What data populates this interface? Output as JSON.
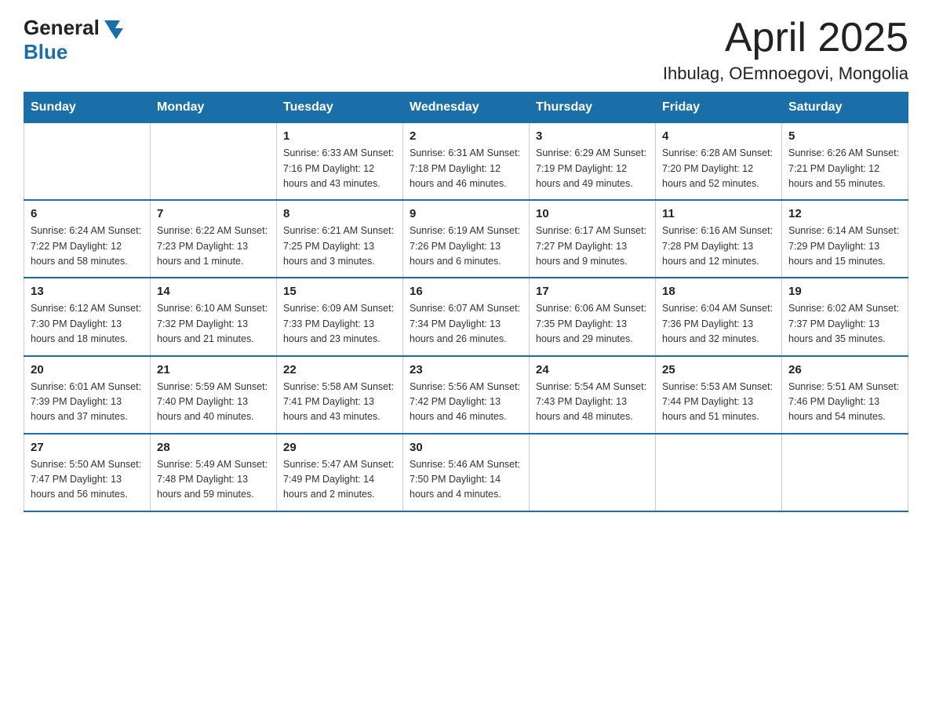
{
  "header": {
    "logo_general": "General",
    "logo_blue": "Blue",
    "title": "April 2025",
    "subtitle": "Ihbulag, OEmnoegovi, Mongolia"
  },
  "days_of_week": [
    "Sunday",
    "Monday",
    "Tuesday",
    "Wednesday",
    "Thursday",
    "Friday",
    "Saturday"
  ],
  "weeks": [
    {
      "days": [
        {
          "number": "",
          "detail": ""
        },
        {
          "number": "",
          "detail": ""
        },
        {
          "number": "1",
          "detail": "Sunrise: 6:33 AM\nSunset: 7:16 PM\nDaylight: 12 hours\nand 43 minutes."
        },
        {
          "number": "2",
          "detail": "Sunrise: 6:31 AM\nSunset: 7:18 PM\nDaylight: 12 hours\nand 46 minutes."
        },
        {
          "number": "3",
          "detail": "Sunrise: 6:29 AM\nSunset: 7:19 PM\nDaylight: 12 hours\nand 49 minutes."
        },
        {
          "number": "4",
          "detail": "Sunrise: 6:28 AM\nSunset: 7:20 PM\nDaylight: 12 hours\nand 52 minutes."
        },
        {
          "number": "5",
          "detail": "Sunrise: 6:26 AM\nSunset: 7:21 PM\nDaylight: 12 hours\nand 55 minutes."
        }
      ]
    },
    {
      "days": [
        {
          "number": "6",
          "detail": "Sunrise: 6:24 AM\nSunset: 7:22 PM\nDaylight: 12 hours\nand 58 minutes."
        },
        {
          "number": "7",
          "detail": "Sunrise: 6:22 AM\nSunset: 7:23 PM\nDaylight: 13 hours\nand 1 minute."
        },
        {
          "number": "8",
          "detail": "Sunrise: 6:21 AM\nSunset: 7:25 PM\nDaylight: 13 hours\nand 3 minutes."
        },
        {
          "number": "9",
          "detail": "Sunrise: 6:19 AM\nSunset: 7:26 PM\nDaylight: 13 hours\nand 6 minutes."
        },
        {
          "number": "10",
          "detail": "Sunrise: 6:17 AM\nSunset: 7:27 PM\nDaylight: 13 hours\nand 9 minutes."
        },
        {
          "number": "11",
          "detail": "Sunrise: 6:16 AM\nSunset: 7:28 PM\nDaylight: 13 hours\nand 12 minutes."
        },
        {
          "number": "12",
          "detail": "Sunrise: 6:14 AM\nSunset: 7:29 PM\nDaylight: 13 hours\nand 15 minutes."
        }
      ]
    },
    {
      "days": [
        {
          "number": "13",
          "detail": "Sunrise: 6:12 AM\nSunset: 7:30 PM\nDaylight: 13 hours\nand 18 minutes."
        },
        {
          "number": "14",
          "detail": "Sunrise: 6:10 AM\nSunset: 7:32 PM\nDaylight: 13 hours\nand 21 minutes."
        },
        {
          "number": "15",
          "detail": "Sunrise: 6:09 AM\nSunset: 7:33 PM\nDaylight: 13 hours\nand 23 minutes."
        },
        {
          "number": "16",
          "detail": "Sunrise: 6:07 AM\nSunset: 7:34 PM\nDaylight: 13 hours\nand 26 minutes."
        },
        {
          "number": "17",
          "detail": "Sunrise: 6:06 AM\nSunset: 7:35 PM\nDaylight: 13 hours\nand 29 minutes."
        },
        {
          "number": "18",
          "detail": "Sunrise: 6:04 AM\nSunset: 7:36 PM\nDaylight: 13 hours\nand 32 minutes."
        },
        {
          "number": "19",
          "detail": "Sunrise: 6:02 AM\nSunset: 7:37 PM\nDaylight: 13 hours\nand 35 minutes."
        }
      ]
    },
    {
      "days": [
        {
          "number": "20",
          "detail": "Sunrise: 6:01 AM\nSunset: 7:39 PM\nDaylight: 13 hours\nand 37 minutes."
        },
        {
          "number": "21",
          "detail": "Sunrise: 5:59 AM\nSunset: 7:40 PM\nDaylight: 13 hours\nand 40 minutes."
        },
        {
          "number": "22",
          "detail": "Sunrise: 5:58 AM\nSunset: 7:41 PM\nDaylight: 13 hours\nand 43 minutes."
        },
        {
          "number": "23",
          "detail": "Sunrise: 5:56 AM\nSunset: 7:42 PM\nDaylight: 13 hours\nand 46 minutes."
        },
        {
          "number": "24",
          "detail": "Sunrise: 5:54 AM\nSunset: 7:43 PM\nDaylight: 13 hours\nand 48 minutes."
        },
        {
          "number": "25",
          "detail": "Sunrise: 5:53 AM\nSunset: 7:44 PM\nDaylight: 13 hours\nand 51 minutes."
        },
        {
          "number": "26",
          "detail": "Sunrise: 5:51 AM\nSunset: 7:46 PM\nDaylight: 13 hours\nand 54 minutes."
        }
      ]
    },
    {
      "days": [
        {
          "number": "27",
          "detail": "Sunrise: 5:50 AM\nSunset: 7:47 PM\nDaylight: 13 hours\nand 56 minutes."
        },
        {
          "number": "28",
          "detail": "Sunrise: 5:49 AM\nSunset: 7:48 PM\nDaylight: 13 hours\nand 59 minutes."
        },
        {
          "number": "29",
          "detail": "Sunrise: 5:47 AM\nSunset: 7:49 PM\nDaylight: 14 hours\nand 2 minutes."
        },
        {
          "number": "30",
          "detail": "Sunrise: 5:46 AM\nSunset: 7:50 PM\nDaylight: 14 hours\nand 4 minutes."
        },
        {
          "number": "",
          "detail": ""
        },
        {
          "number": "",
          "detail": ""
        },
        {
          "number": "",
          "detail": ""
        }
      ]
    }
  ]
}
